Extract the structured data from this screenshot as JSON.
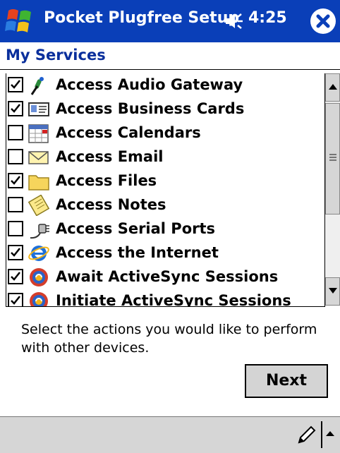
{
  "titlebar": {
    "title": "Pocket Plugfree Setup",
    "time": "4:25"
  },
  "section": {
    "title": "My Services"
  },
  "services": [
    {
      "label": "Access Audio Gateway",
      "checked": true,
      "icon": "microphone-icon"
    },
    {
      "label": "Access Business Cards",
      "checked": true,
      "icon": "business-card-icon"
    },
    {
      "label": "Access Calendars",
      "checked": false,
      "icon": "calendar-icon"
    },
    {
      "label": "Access Email",
      "checked": false,
      "icon": "envelope-icon"
    },
    {
      "label": "Access Files",
      "checked": true,
      "icon": "folder-icon"
    },
    {
      "label": "Access Notes",
      "checked": false,
      "icon": "notes-icon"
    },
    {
      "label": "Access Serial Ports",
      "checked": false,
      "icon": "serial-port-icon"
    },
    {
      "label": "Access the Internet",
      "checked": true,
      "icon": "internet-explorer-icon"
    },
    {
      "label": "Await ActiveSync Sessions",
      "checked": true,
      "icon": "activesync-icon"
    },
    {
      "label": "Initiate ActiveSync Sessions",
      "checked": true,
      "icon": "activesync-icon"
    }
  ],
  "hint": "Select the actions you would like to perform with other devices.",
  "buttons": {
    "next": "Next"
  },
  "colors": {
    "titlebar": "#0a3fb8",
    "section_title": "#0a2f9c",
    "commandbar": "#d6d6d6"
  }
}
